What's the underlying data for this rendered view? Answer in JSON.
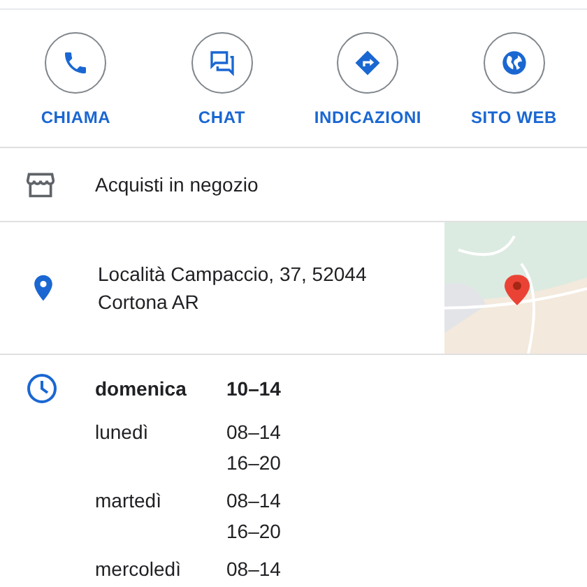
{
  "actions": [
    {
      "kind": "phone",
      "label": "CHIAMA"
    },
    {
      "kind": "chat",
      "label": "CHAT"
    },
    {
      "kind": "directions",
      "label": "INDICAZIONI"
    },
    {
      "kind": "web",
      "label": "SITO WEB"
    }
  ],
  "store": {
    "label": "Acquisti in negozio"
  },
  "address": {
    "lines": [
      "Località Campaccio, 37, 52044",
      "Cortona AR"
    ]
  },
  "hours": [
    {
      "day": "domenica",
      "today": true,
      "ranges": [
        "10–14"
      ]
    },
    {
      "day": "lunedì",
      "today": false,
      "ranges": [
        "08–14",
        "16–20"
      ]
    },
    {
      "day": "martedì",
      "today": false,
      "ranges": [
        "08–14",
        "16–20"
      ]
    },
    {
      "day": "mercoledì",
      "today": false,
      "ranges": [
        "08–14"
      ]
    }
  ]
}
